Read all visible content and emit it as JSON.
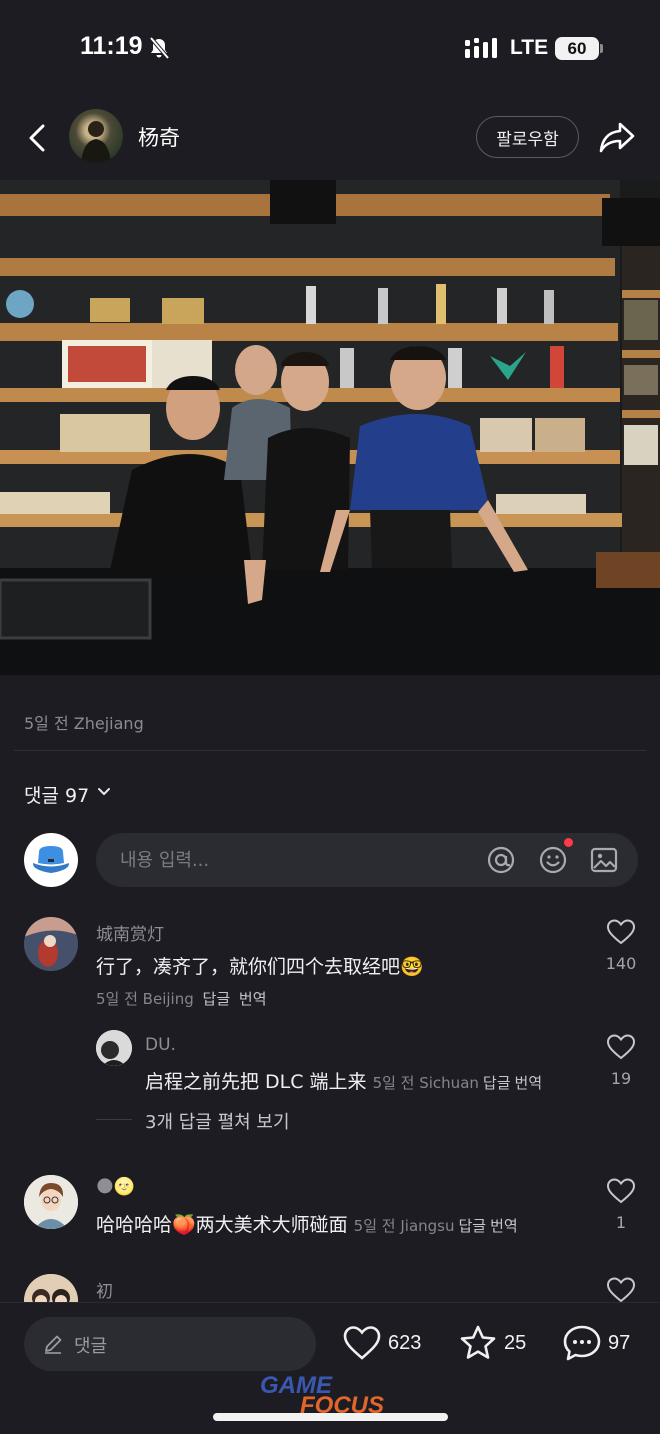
{
  "status_bar": {
    "time": "11:19",
    "network": "LTE",
    "battery": "60"
  },
  "header": {
    "author": "杨奇",
    "follow_label": "팔로우함"
  },
  "post": {
    "meta": "5일 전 Zhejiang"
  },
  "comments_header": {
    "label": "댓글 97"
  },
  "comment_input": {
    "placeholder": "내용 입력..."
  },
  "comments": [
    {
      "user": "城南赏灯",
      "text": "行了，凑齐了，就你们四个去取经吧🤓",
      "meta": "5일 전 Beijing",
      "reply_label": "답글",
      "translate_label": "번역",
      "likes": "140",
      "reply": {
        "user": "DU.",
        "text": "启程之前先把 DLC 端上来",
        "meta": "5일 전 Sichuan",
        "reply_label": "답글",
        "translate_label": "번역",
        "likes": "19"
      },
      "expand_label": "3개 답글 펼쳐 보기"
    },
    {
      "user": "🌑🌝",
      "text": "哈哈哈哈🍑两大美术大师碰面",
      "meta": "5일 전 Jiangsu",
      "reply_label": "답글",
      "translate_label": "번역",
      "likes": "1"
    },
    {
      "user": "初"
    }
  ],
  "bottom_bar": {
    "comment_placeholder": "댓글",
    "likes": "623",
    "favorites": "25",
    "comments": "97"
  },
  "watermark": {
    "line1": "GAME",
    "line2": "FOCUS"
  },
  "colors": {
    "background": "#1c1c22",
    "input": "#2b2b32",
    "notification_dot": "#ff3b48"
  }
}
